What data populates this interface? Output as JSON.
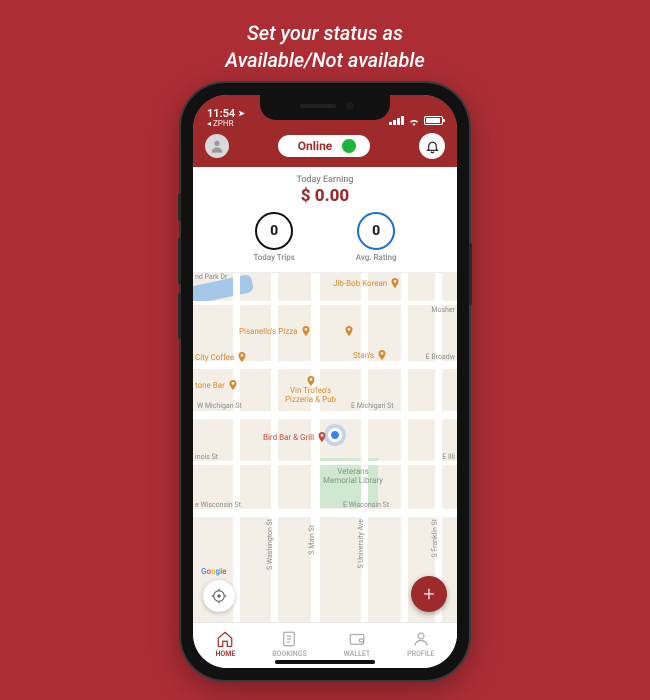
{
  "promo": {
    "line1": "Set your status as",
    "line2": "Available/Not available"
  },
  "statusBar": {
    "time": "11:54",
    "backApp": "ZPHR"
  },
  "header": {
    "statusLabel": "Online"
  },
  "earnings": {
    "label": "Today Earning",
    "amount": "$ 0.00",
    "trips": {
      "value": "0",
      "label": "Today Trips"
    },
    "rating": {
      "value": "0",
      "label": "Avg. Rating"
    }
  },
  "map": {
    "pois": {
      "jibbob": "Jib-Bob Korean",
      "pisanello": "Pisanello's Pizza",
      "citycoffee": "City Coffee",
      "stans": "Stan's",
      "stonebar": "tone Bar",
      "vintrofeo1": "Vin Trofeo's",
      "vintrofeo2": "Pizzeria & Pub",
      "birdbar": "Bird Bar & Grill",
      "veterans1": "Veterans",
      "veterans2": "Memorial Library"
    },
    "roads": {
      "parkdr": "nd Park Dr",
      "mosher": "Mosher",
      "ebroadw": "E Broadw",
      "wmich": "W Michigan St",
      "emich": "E Michigan St",
      "inois": "inois St",
      "eilli": "E Illi",
      "ewisc": "E Wisconsin St",
      "wisconsin": "e Wisconsin St",
      "swash": "S Washington St",
      "smain": "S Main St",
      "suniv": "S University Ave",
      "sfrank": "S Franklin St"
    },
    "attribution": "Google"
  },
  "nav": {
    "home": "HOME",
    "bookings": "BOOKINGS",
    "wallet": "WALLET",
    "profile": "PROFILE"
  }
}
